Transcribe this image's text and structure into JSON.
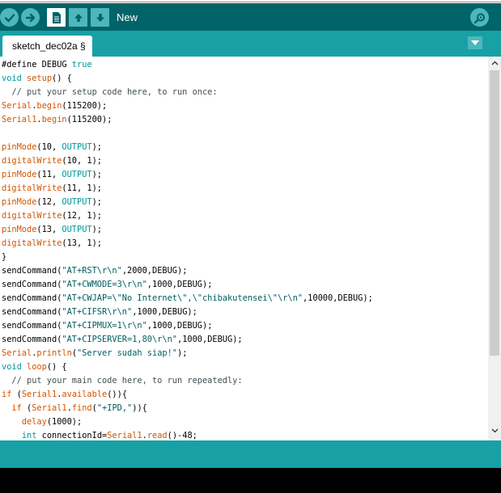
{
  "toolbar": {
    "hover_label": "New",
    "buttons": [
      {
        "name": "verify-button",
        "icon": "check-icon"
      },
      {
        "name": "upload-button",
        "icon": "arrow-right-icon"
      },
      {
        "name": "new-button",
        "icon": "new-file-icon"
      },
      {
        "name": "open-button",
        "icon": "arrow-up-icon"
      },
      {
        "name": "save-button",
        "icon": "arrow-down-icon"
      },
      {
        "name": "serial-monitor-button",
        "icon": "magnifier-icon"
      }
    ]
  },
  "tabs": [
    {
      "label": "sketch_dec02a §",
      "active": true
    }
  ],
  "colors": {
    "toolbar": "#006468",
    "tabbar": "#17a1a5",
    "button": "#4db7bb",
    "keyword": "#d35400",
    "type": "#00979c",
    "comment": "#434f54",
    "string": "#005c5f"
  },
  "code_lines": [
    [
      {
        "t": "#define DEBUG ",
        "c": "n"
      },
      {
        "t": "true",
        "c": "ty"
      }
    ],
    [
      {
        "t": "void",
        "c": "ty"
      },
      {
        "t": " ",
        "c": "n"
      },
      {
        "t": "setup",
        "c": "kw"
      },
      {
        "t": "() {",
        "c": "n"
      }
    ],
    [
      {
        "t": "  // put your setup code here, to run once:",
        "c": "cm"
      }
    ],
    [
      {
        "t": "Serial",
        "c": "kw"
      },
      {
        "t": ".",
        "c": "n"
      },
      {
        "t": "begin",
        "c": "kw"
      },
      {
        "t": "(115200);",
        "c": "n"
      }
    ],
    [
      {
        "t": "Serial1",
        "c": "kw"
      },
      {
        "t": ".",
        "c": "n"
      },
      {
        "t": "begin",
        "c": "kw"
      },
      {
        "t": "(115200);",
        "c": "n"
      }
    ],
    [],
    [
      {
        "t": "pinMode",
        "c": "kw"
      },
      {
        "t": "(10, ",
        "c": "n"
      },
      {
        "t": "OUTPUT",
        "c": "ty"
      },
      {
        "t": ");",
        "c": "n"
      }
    ],
    [
      {
        "t": "digitalWrite",
        "c": "kw"
      },
      {
        "t": "(10, 1);",
        "c": "n"
      }
    ],
    [
      {
        "t": "pinMode",
        "c": "kw"
      },
      {
        "t": "(11, ",
        "c": "n"
      },
      {
        "t": "OUTPUT",
        "c": "ty"
      },
      {
        "t": ");",
        "c": "n"
      }
    ],
    [
      {
        "t": "digitalWrite",
        "c": "kw"
      },
      {
        "t": "(11, 1);",
        "c": "n"
      }
    ],
    [
      {
        "t": "pinMode",
        "c": "kw"
      },
      {
        "t": "(12, ",
        "c": "n"
      },
      {
        "t": "OUTPUT",
        "c": "ty"
      },
      {
        "t": ");",
        "c": "n"
      }
    ],
    [
      {
        "t": "digitalWrite",
        "c": "kw"
      },
      {
        "t": "(12, 1);",
        "c": "n"
      }
    ],
    [
      {
        "t": "pinMode",
        "c": "kw"
      },
      {
        "t": "(13, ",
        "c": "n"
      },
      {
        "t": "OUTPUT",
        "c": "ty"
      },
      {
        "t": ");",
        "c": "n"
      }
    ],
    [
      {
        "t": "digitalWrite",
        "c": "kw"
      },
      {
        "t": "(13, 1);",
        "c": "n"
      }
    ],
    [
      {
        "t": "}",
        "c": "n"
      }
    ],
    [
      {
        "t": "sendCommand(",
        "c": "n"
      },
      {
        "t": "\"AT+RST\\r\\n\"",
        "c": "st"
      },
      {
        "t": ",2000,DEBUG);",
        "c": "n"
      }
    ],
    [
      {
        "t": "sendCommand(",
        "c": "n"
      },
      {
        "t": "\"AT+CWMODE=3\\r\\n\"",
        "c": "st"
      },
      {
        "t": ",1000,DEBUG);",
        "c": "n"
      }
    ],
    [
      {
        "t": "sendCommand(",
        "c": "n"
      },
      {
        "t": "\"AT+CWJAP=\\\"No Internet\\\",\\\"chibakutensei\\\"\\r\\n\"",
        "c": "st"
      },
      {
        "t": ",10000,DEBUG);",
        "c": "n"
      }
    ],
    [
      {
        "t": "sendCommand(",
        "c": "n"
      },
      {
        "t": "\"AT+CIFSR\\r\\n\"",
        "c": "st"
      },
      {
        "t": ",1000,DEBUG);",
        "c": "n"
      }
    ],
    [
      {
        "t": "sendCommand(",
        "c": "n"
      },
      {
        "t": "\"AT+CIPMUX=1\\r\\n\"",
        "c": "st"
      },
      {
        "t": ",1000,DEBUG);",
        "c": "n"
      }
    ],
    [
      {
        "t": "sendCommand(",
        "c": "n"
      },
      {
        "t": "\"AT+CIPSERVER=1,80\\r\\n\"",
        "c": "st"
      },
      {
        "t": ",1000,DEBUG);",
        "c": "n"
      }
    ],
    [
      {
        "t": "Serial",
        "c": "kw"
      },
      {
        "t": ".",
        "c": "n"
      },
      {
        "t": "println",
        "c": "kw"
      },
      {
        "t": "(",
        "c": "n"
      },
      {
        "t": "\"Server sudah siap!\"",
        "c": "st"
      },
      {
        "t": ");",
        "c": "n"
      }
    ],
    [
      {
        "t": "void",
        "c": "ty"
      },
      {
        "t": " ",
        "c": "n"
      },
      {
        "t": "loop",
        "c": "kw"
      },
      {
        "t": "() {",
        "c": "n"
      }
    ],
    [
      {
        "t": "  // put your main code here, to run repeatedly:",
        "c": "cm"
      }
    ],
    [
      {
        "t": "if",
        "c": "kw"
      },
      {
        "t": " (",
        "c": "n"
      },
      {
        "t": "Serial1",
        "c": "kw"
      },
      {
        "t": ".",
        "c": "n"
      },
      {
        "t": "available",
        "c": "kw"
      },
      {
        "t": "()){",
        "c": "n"
      }
    ],
    [
      {
        "t": "  ",
        "c": "n"
      },
      {
        "t": "if",
        "c": "kw"
      },
      {
        "t": " (",
        "c": "n"
      },
      {
        "t": "Serial1",
        "c": "kw"
      },
      {
        "t": ".",
        "c": "n"
      },
      {
        "t": "find",
        "c": "kw"
      },
      {
        "t": "(",
        "c": "n"
      },
      {
        "t": "\"+IPD,\"",
        "c": "st"
      },
      {
        "t": ")){",
        "c": "n"
      }
    ],
    [
      {
        "t": "    ",
        "c": "n"
      },
      {
        "t": "delay",
        "c": "kw"
      },
      {
        "t": "(1000);",
        "c": "n"
      }
    ],
    [
      {
        "t": "    ",
        "c": "n"
      },
      {
        "t": "int",
        "c": "ty"
      },
      {
        "t": " connectionId=",
        "c": "n"
      },
      {
        "t": "Serial1",
        "c": "kw"
      },
      {
        "t": ".",
        "c": "n"
      },
      {
        "t": "read",
        "c": "kw"
      },
      {
        "t": "()-48;",
        "c": "n"
      }
    ]
  ]
}
